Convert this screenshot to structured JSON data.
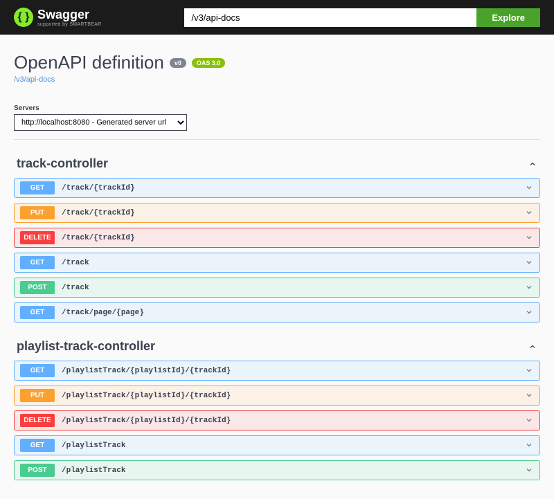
{
  "topbar": {
    "logo_text": "Swagger",
    "logo_sub": "supported by SMARTBEAR",
    "search_value": "/v3/api-docs",
    "explore_label": "Explore"
  },
  "header": {
    "title": "OpenAPI definition",
    "version_badge": "v0",
    "oas_badge": "OAS 3.0",
    "docs_link": "/v3/api-docs"
  },
  "servers": {
    "label": "Servers",
    "selected": "http://localhost:8080 - Generated server url"
  },
  "sections": [
    {
      "name": "track-controller",
      "endpoints": [
        {
          "method": "GET",
          "path": "/track/{trackId}"
        },
        {
          "method": "PUT",
          "path": "/track/{trackId}"
        },
        {
          "method": "DELETE",
          "path": "/track/{trackId}"
        },
        {
          "method": "GET",
          "path": "/track"
        },
        {
          "method": "POST",
          "path": "/track"
        },
        {
          "method": "GET",
          "path": "/track/page/{page}"
        }
      ]
    },
    {
      "name": "playlist-track-controller",
      "endpoints": [
        {
          "method": "GET",
          "path": "/playlistTrack/{playlistId}/{trackId}"
        },
        {
          "method": "PUT",
          "path": "/playlistTrack/{playlistId}/{trackId}"
        },
        {
          "method": "DELETE",
          "path": "/playlistTrack/{playlistId}/{trackId}"
        },
        {
          "method": "GET",
          "path": "/playlistTrack"
        },
        {
          "method": "POST",
          "path": "/playlistTrack"
        }
      ]
    }
  ]
}
